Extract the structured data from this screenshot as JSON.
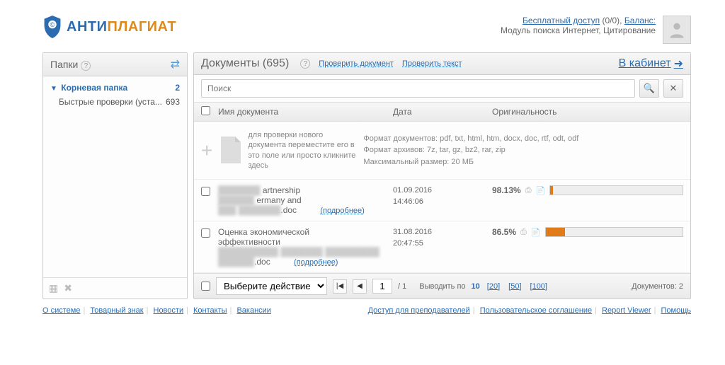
{
  "header": {
    "logo1": "АНТИ",
    "logo2": "ПЛАГИАТ",
    "free_access": "Бесплатный доступ",
    "free_frac": "(0/0),",
    "balance": "Баланс:",
    "sub": "Модуль поиска Интернет, Цитирование"
  },
  "sidebar": {
    "title": "Папки",
    "root": {
      "label": "Корневая папка",
      "count": "2"
    },
    "child": {
      "label": "Быстрые проверки (уста...",
      "count": "693"
    }
  },
  "content": {
    "title": "Документы (695)",
    "check_doc": "Проверить документ",
    "check_text": "Проверить текст",
    "cabinet": "В кабинет",
    "search_ph": "Поиск",
    "col_name": "Имя документа",
    "col_date": "Дата",
    "col_orig": "Оригинальность",
    "upload_hint": "для проверки нового документа переместите его в это поле или просто кликните здесь",
    "fmt_docs": "Формат документов: pdf, txt, html, htm, docx, doc, rtf, odt, odf",
    "fmt_arch": "Формат архивов: 7z, tar, gz, bz2, rar, zip",
    "fmt_max": "Максимальный размер: 20 МБ",
    "rows": [
      {
        "name_blur": "███████ ",
        "name2": "artnership",
        "name_blur2": "██████ ",
        "name3": "ermany and",
        "name_blur3": "███ ███████",
        "ext": ".doc",
        "more": "(подробнее)",
        "date": "01.09.2016",
        "time": "14:46:06",
        "orig": "98.13%",
        "fill": 2
      },
      {
        "name1": "Оценка экономической",
        "name2": "эффективности",
        "name_blur3": "██████████ ███████ █████████ ██████",
        "ext": ".doc",
        "more": "(подробнее)",
        "date": "31.08.2016",
        "time": "20:47:55",
        "orig": "86.5%",
        "fill": 14
      }
    ],
    "action_label": "Выберите действие",
    "page": "1",
    "pages": "/ 1",
    "per": "Выводить по",
    "p10": "10",
    "p20": "[20]",
    "p50": "[50]",
    "p100": "[100]",
    "doc_count": "Документов: 2"
  },
  "footnav": {
    "left": [
      "О системе",
      "Товарный знак",
      "Новости",
      "Контакты",
      "Вакансии"
    ],
    "right": [
      "Доступ для преподавателей",
      "Пользовательское соглашение",
      "Report Viewer",
      "Помощь"
    ]
  }
}
